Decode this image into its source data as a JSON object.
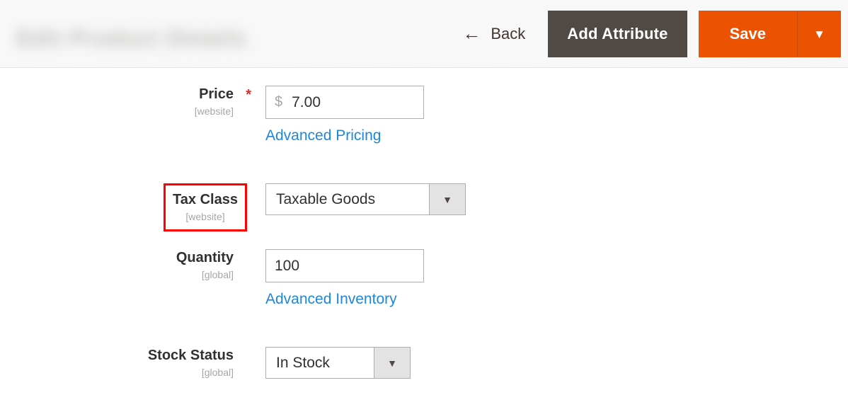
{
  "header": {
    "page_title_redacted": "Edit Product Details",
    "back_button": {
      "label": "Back",
      "icon": "arrow-left-icon",
      "glyph": "←"
    },
    "add_attribute_button": {
      "label": "Add Attribute"
    },
    "save_button": {
      "label": "Save",
      "toggle_glyph": "▼"
    },
    "colors": {
      "save_orange": "#eb5202",
      "add_attribute_dark": "#514943",
      "header_background": "#f8f8f8"
    }
  },
  "form": {
    "fields": [
      {
        "label": "Price",
        "scope": "[website]",
        "required": true,
        "required_marker": "*",
        "control": "text",
        "currency_symbol": "$",
        "value": "7.00",
        "link": "Advanced Pricing",
        "highlighted": false
      },
      {
        "label": "Tax Class",
        "scope": "[website]",
        "required": false,
        "control": "select",
        "value": "Taxable Goods",
        "arrow_glyph": "▼",
        "highlighted": true,
        "highlight_color": "#ff0000"
      },
      {
        "label": "Quantity",
        "scope": "[global]",
        "required": false,
        "control": "text",
        "value": "100",
        "link": "Advanced Inventory",
        "highlighted": false
      },
      {
        "label": "Stock Status",
        "scope": "[global]",
        "required": false,
        "control": "select",
        "value": "In Stock",
        "arrow_glyph": "▼",
        "highlighted": false
      }
    ],
    "link_color": "#1e87db"
  }
}
